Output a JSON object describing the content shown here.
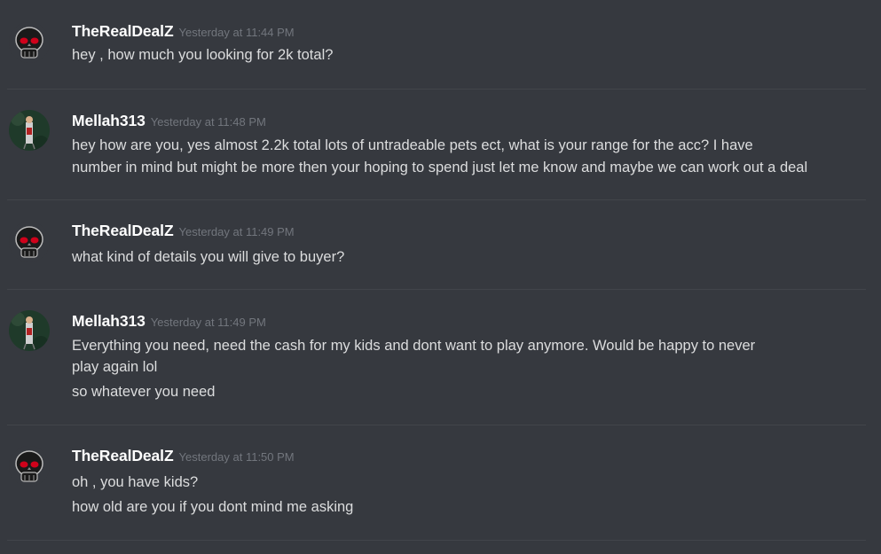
{
  "messages": [
    {
      "author": "TheRealDealZ",
      "timestamp": "Yesterday at 11:44 PM",
      "avatar_icon": "skull-avatar-icon",
      "lines": [
        "hey , how much you looking for 2k total?"
      ]
    },
    {
      "author": "Mellah313",
      "timestamp": "Yesterday at 11:48 PM",
      "avatar_icon": "character-avatar-icon",
      "lines": [
        "hey how are you, yes almost 2.2k total lots of untradeable  pets ect, what is your range for the acc? I have",
        "number in mind but might be more then your hoping to spend just let me know and maybe we can work out a deal"
      ]
    },
    {
      "author": "TheRealDealZ",
      "timestamp": "Yesterday at 11:49 PM",
      "avatar_icon": "skull-avatar-icon",
      "lines": [
        "what kind of details you will give to buyer?"
      ]
    },
    {
      "author": "Mellah313",
      "timestamp": "Yesterday at 11:49 PM",
      "avatar_icon": "character-avatar-icon",
      "lines": [
        "Everything you need,  need the cash for my kids and dont want to play anymore. Would be happy to never",
        "play again lol",
        "so whatever you need"
      ]
    },
    {
      "author": "TheRealDealZ",
      "timestamp": "Yesterday at 11:50 PM",
      "avatar_icon": "skull-avatar-icon",
      "lines": [
        "oh , you have kids?",
        "how old are you if you dont mind me asking"
      ]
    }
  ],
  "colors": {
    "background": "#36393f",
    "username": "#ffffff",
    "timestamp": "#72767d",
    "message_text": "#dcddde",
    "divider": "#42454a"
  }
}
